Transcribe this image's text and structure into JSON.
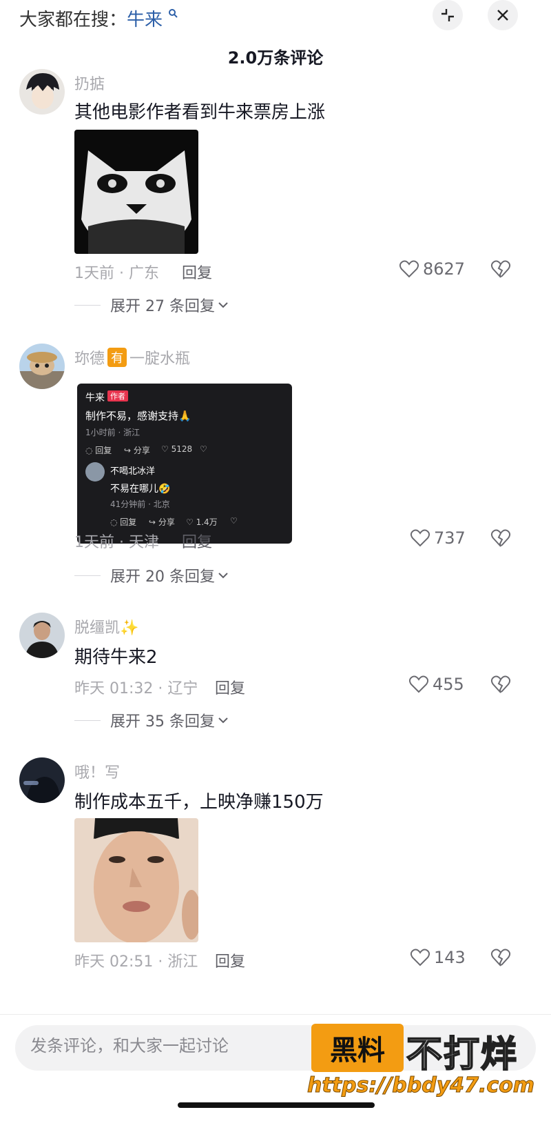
{
  "header": {
    "search_prefix": "大家都在搜：",
    "search_keyword": "牛来",
    "comment_count": "2.0万条评论"
  },
  "comments": [
    {
      "username": "扔掂",
      "text": "其他电影作者看到牛来票房上涨",
      "time_location": "1天前 · 广东",
      "reply_label": "回复",
      "likes": "8627",
      "expand_label": "展开 27 条回复"
    },
    {
      "username_part1": "珎德",
      "badge": "有",
      "username_part2": "一腚水瓶",
      "embedded": {
        "author": "牛来",
        "author_tag": "作者",
        "text": "制作不易，感谢支持🙏",
        "meta": "1小时前 · 浙江",
        "reply": "回复",
        "share": "分享",
        "likes": "5128",
        "sub_author": "不喝北冰洋",
        "sub_text": "不易在哪儿🤣",
        "sub_meta": "41分钟前 · 北京",
        "sub_reply": "回复",
        "sub_share": "分享",
        "sub_likes": "1.4万"
      },
      "time_location": "1天前 · 天津",
      "reply_label": "回复",
      "likes": "737",
      "expand_label": "展开 20 条回复"
    },
    {
      "username": "脱缰凯✨",
      "text": "期待牛来2",
      "time_location": "昨天 01:32 · 辽宁",
      "reply_label": "回复",
      "likes": "455",
      "expand_label": "展开 35 条回复"
    },
    {
      "username": "哦！写",
      "text": "制作成本五千，上映净赚150万",
      "time_location": "昨天 02:51 · 浙江",
      "reply_label": "回复",
      "likes": "143"
    }
  ],
  "input": {
    "placeholder": "发条评论，和大家一起讨论"
  },
  "watermark": {
    "box": "黑料",
    "text": "不打烊",
    "url": "https://bbdy47.com"
  },
  "colors": {
    "accent_keyword": "#2c5fa8",
    "watermark_orange": "#f39c12"
  }
}
